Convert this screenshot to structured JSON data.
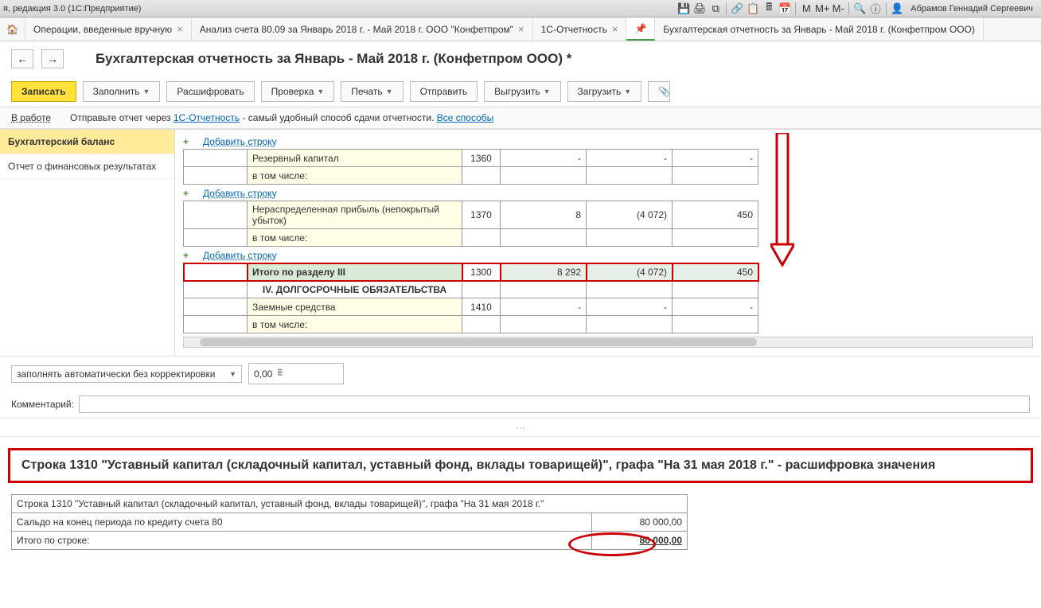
{
  "app_title": "я, редакция 3.0   (1С:Предприятие)",
  "user_name": "Абрамов Геннадий Сергеевич",
  "mbuttons": [
    "M",
    "M+",
    "M-"
  ],
  "tabs": [
    {
      "label": "Операции, введенные вручную",
      "closable": true
    },
    {
      "label": "Анализ счета 80.09 за Январь 2018 г. - Май 2018 г. ООО \"Конфетпром\"",
      "closable": true
    },
    {
      "label": "1С-Отчетность",
      "closable": true
    },
    {
      "label": "",
      "pin": true
    },
    {
      "label": "Бухгалтерская отчетность за Январь - Май 2018 г. (Конфетпром ООО)",
      "closable": false,
      "active": true
    }
  ],
  "page_title": "Бухгалтерская отчетность за Январь - Май 2018 г. (Конфетпром ООО) *",
  "toolbar": {
    "save": "Записать",
    "fill": "Заполнить",
    "decode": "Расшифровать",
    "check": "Проверка",
    "print": "Печать",
    "send": "Отправить",
    "upload": "Выгрузить",
    "load": "Загрузить"
  },
  "status": "В работе",
  "info_prefix": "Отправьте отчет через ",
  "info_link": "1С-Отчетность",
  "info_suffix": " - самый удобный способ сдачи отчетности. ",
  "info_all": "Все способы",
  "sidebar": {
    "items": [
      "Бухгалтерский баланс",
      "Отчет о финансовых результатах"
    ]
  },
  "add_row": "Добавить строку",
  "rows": {
    "r1": {
      "label": "Резервный капитал",
      "code": "1360",
      "c1": "-",
      "c2": "-",
      "c3": "-"
    },
    "r1s": {
      "label": "в том числе:"
    },
    "r2": {
      "label": "Нераспределенная прибыль (непокрытый убыток)",
      "code": "1370",
      "c1": "8",
      "c2": "(4 072)",
      "c3": "450"
    },
    "r2s": {
      "label": "в том числе:"
    },
    "r3": {
      "label": "Итого по разделу III",
      "code": "1300",
      "c1": "8 292",
      "c2": "(4 072)",
      "c3": "450"
    },
    "r4h": {
      "label": "IV. ДОЛГОСРОЧНЫЕ ОБЯЗАТЕЛЬСТВА"
    },
    "r4": {
      "label": "Заемные средства",
      "code": "1410",
      "c1": "-",
      "c2": "-",
      "c3": "-"
    },
    "r4s": {
      "label": "в том числе:"
    }
  },
  "auto_mode": "заполнять автоматически без корректировки",
  "num_value": "0,00",
  "comment_label": "Комментарий:",
  "decode_title": "Строка 1310 \"Уставный капитал (складочный капитал, уставный фонд, вклады товарищей)\", графа \"На 31 мая 2018 г.\" - расшифровка значения",
  "detail": {
    "header": "Строка 1310 \"Уставный капитал (складочный капитал, уставный фонд, вклады товарищей)\", графа \"На 31 мая 2018 г.\"",
    "row1_label": "Сальдо на конец периода по кредиту счета 80",
    "row1_val": "80 000,00",
    "total_label": "Итого по строке:",
    "total_val": "80 000,00"
  }
}
